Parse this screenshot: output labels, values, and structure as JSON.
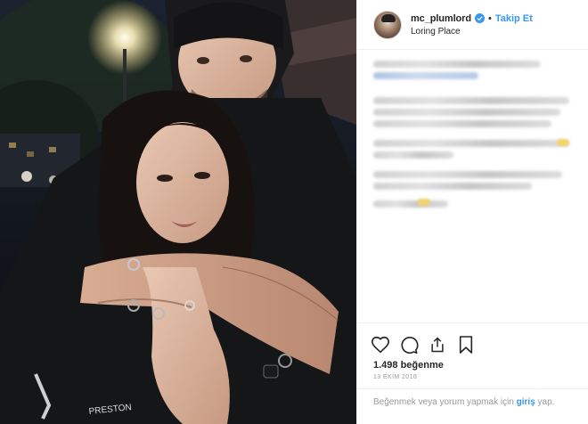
{
  "post": {
    "username": "mc_plumlord",
    "separator": "•",
    "follow_label": "Takip Et",
    "location": "Loring Place",
    "likes_text": "1.498 beğenme",
    "date_text": "13 EKİM 2018",
    "comment_prompt": "Beğenmek veya yorum yapmak için",
    "login_label": "giriş",
    "login_tail": "yap."
  },
  "icons": {
    "like": "heart-icon",
    "comment": "comment-icon",
    "share": "share-icon",
    "save": "bookmark-icon",
    "verified": "verified-badge-icon"
  },
  "colors": {
    "accent": "#3897f0",
    "text": "#262626",
    "muted": "#999999",
    "border": "#efefef"
  }
}
